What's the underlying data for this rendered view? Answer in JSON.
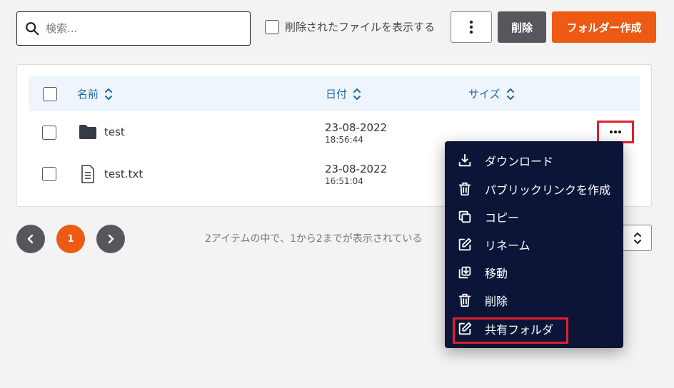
{
  "toolbar": {
    "search_placeholder": "検索...",
    "show_deleted_label": "削除されたファイルを表示する",
    "delete_label": "削除",
    "create_folder_label": "フォルダー作成"
  },
  "table": {
    "headers": {
      "name": "名前",
      "date": "日付",
      "size": "サイズ"
    },
    "rows": [
      {
        "type": "folder",
        "name": "test",
        "date": "23-08-2022",
        "time": "18:56:44"
      },
      {
        "type": "file",
        "name": "test.txt",
        "date": "23-08-2022",
        "time": "16:51:04"
      }
    ]
  },
  "pagination": {
    "current_page": "1",
    "info": "2アイテムの中で、1から2までが表示されている"
  },
  "context_menu": {
    "items": [
      {
        "label": "ダウンロード",
        "icon": "download-icon"
      },
      {
        "label": "パブリックリンクを作成",
        "icon": "trash-icon"
      },
      {
        "label": "コピー",
        "icon": "copy-icon"
      },
      {
        "label": "リネーム",
        "icon": "edit-icon"
      },
      {
        "label": "移動",
        "icon": "move-icon"
      },
      {
        "label": "削除",
        "icon": "trash-icon"
      },
      {
        "label": "共有フォルダ",
        "icon": "edit-icon"
      }
    ]
  },
  "colors": {
    "accent": "#ec5a14",
    "header_text": "#1f66a8",
    "menu_bg": "#0c1538",
    "highlight": "#e0202b"
  }
}
